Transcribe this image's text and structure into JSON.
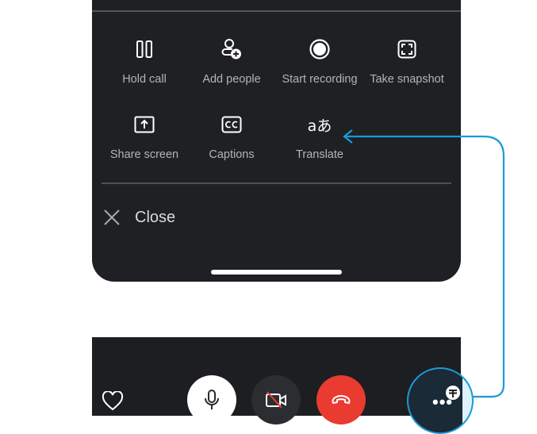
{
  "more_menu": {
    "actions": [
      {
        "label": "Hold call",
        "icon": "pause-icon"
      },
      {
        "label": "Add people",
        "icon": "add-person-icon"
      },
      {
        "label": "Start recording",
        "icon": "record-icon"
      },
      {
        "label": "Take snapshot",
        "icon": "snapshot-icon"
      },
      {
        "label": "Share screen",
        "icon": "share-screen-icon"
      },
      {
        "label": "Captions",
        "icon": "captions-icon"
      },
      {
        "label": "Translate",
        "icon": "translate-icon"
      }
    ],
    "close_label": "Close",
    "translate_glyph": "aあ",
    "captions_glyph": "CC"
  },
  "call_controls": {
    "react": "heart-icon",
    "mic": "microphone-icon",
    "camera": "camera-off-icon",
    "end_call": "end-call-icon",
    "more_glyph": "•••",
    "more": "more-options-icon"
  },
  "colors": {
    "sheet_background": "#1f2023",
    "label_text": "#b3b4b7",
    "end_call_red": "#ea3b30",
    "callout_blue": "#1a9ad6"
  }
}
